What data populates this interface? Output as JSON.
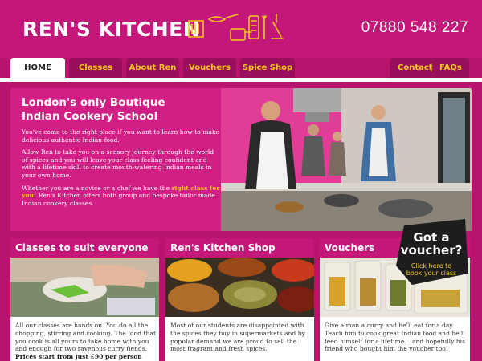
{
  "header": {
    "logo": "REN'S KITCHEN",
    "phone": "07880 548 227"
  },
  "nav": {
    "tabs": [
      {
        "label": "HOME",
        "active": true
      },
      {
        "label": "Classes",
        "active": false
      },
      {
        "label": "About Ren",
        "active": false
      },
      {
        "label": "Vouchers",
        "active": false
      },
      {
        "label": "Spice Shop",
        "active": false
      }
    ],
    "contact": "Contact",
    "separator": "|",
    "faqs": "FAQs"
  },
  "hero": {
    "title_line1": "London's only Boutique",
    "title_line2": "Indian Cookery School",
    "p1": "You've come to the right place if you want to learn how to make delicious authentic Indian food.",
    "p2": "Allow Ren to take you on a sensory journey through the world of spices and you will leave your class feeling confident and with a lifetime skill to create mouth-watering Indian meals in your own home.",
    "p3_start": "Whether you are a novice or a chef we have the",
    "p3_highlight": "right class for you!",
    "p3_end": "Ren's Kitchen offers both group and bespoke tailor made Indian cookery classes."
  },
  "panels": [
    {
      "title": "Classes to suit everyone",
      "text": "All our classes are hands on. You do all the chopping, stirring and cooking. The food that you cook is all yours to take home with you and enough for two ravenous curry fiends.",
      "strong": "Prices start from just £90 per person"
    },
    {
      "title": "Ren's Kitchen Shop",
      "text": "Most of our students are disappointed with the spices they buy in supermarkets and by popular demand we are proud to sell the most fragrant and fresh spices."
    },
    {
      "title": "Vouchers",
      "text": "Give a man a curry and he'll eat for a day. Teach him to cook great Indian food and he'll feed himself for a lifetime....and hopefully his friend who bought him the voucher too!"
    }
  ],
  "badge": {
    "title_line1": "Got a",
    "title_line2": "voucher?",
    "sub_line1": "Click here to",
    "sub_line2": "book your class"
  },
  "colors": {
    "brand": "#c4177a",
    "accent": "#f3c81e",
    "tab": "#9a0f5c"
  },
  "icons": [
    "kitchen-tools-icon"
  ]
}
